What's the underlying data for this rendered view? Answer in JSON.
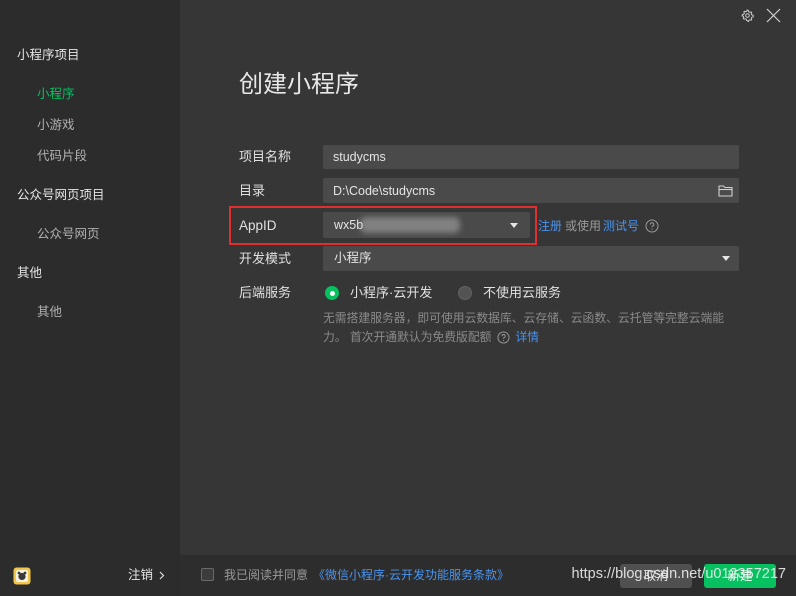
{
  "dialog": {
    "title": "创建小程序"
  },
  "sidebar": {
    "sections": [
      {
        "label": "小程序项目",
        "items": [
          {
            "label": "小程序",
            "selected": true
          },
          {
            "label": "小游戏",
            "selected": false
          },
          {
            "label": "代码片段",
            "selected": false
          }
        ]
      },
      {
        "label": "公众号网页项目",
        "items": [
          {
            "label": "公众号网页",
            "selected": false
          }
        ]
      },
      {
        "label": "其他",
        "items": [
          {
            "label": "其他",
            "selected": false
          }
        ]
      }
    ],
    "logout_label": "注销"
  },
  "form": {
    "project_name": {
      "label": "项目名称",
      "value": "studycms"
    },
    "directory": {
      "label": "目录",
      "value": "D:\\Code\\studycms"
    },
    "appid": {
      "label": "AppID",
      "value": "wx5b",
      "register_link": "注册",
      "or_use_text": "或使用",
      "test_account_link": "测试号"
    },
    "dev_mode": {
      "label": "开发模式",
      "value": "小程序"
    },
    "backend_service": {
      "label": "后端服务",
      "options": [
        {
          "label": "小程序·云开发",
          "selected": true
        },
        {
          "label": "不使用云服务",
          "selected": false
        }
      ],
      "description_line1": "无需搭建服务器，即可使用云数据库、云存储、云函数、云托管等完整云端能",
      "description_line2": "力。 首次开通默认为免费版配额",
      "details_link": "详情"
    }
  },
  "footer": {
    "agree_checked": false,
    "agree_text": "我已阅读并同意",
    "terms_link": "《微信小程序·云开发功能服务条款》",
    "cancel_label": "取消",
    "create_label": "新建"
  },
  "watermark": "https://blog.csdn.net/u012357217",
  "colors": {
    "accent": "#07c160",
    "link": "#4a94f0",
    "highlight_box": "#e02f2f",
    "sidebar_bg": "#2c2c2c",
    "main_bg": "#363636",
    "input_bg": "#4a4a4a"
  },
  "icons": {
    "settings": "gear-icon",
    "close": "close-icon",
    "folder": "folder-icon",
    "dropdown": "caret-down-icon",
    "help": "question-circle-icon",
    "logout_chevron": "chevron-right-icon",
    "avatar": "avatar-icon"
  }
}
